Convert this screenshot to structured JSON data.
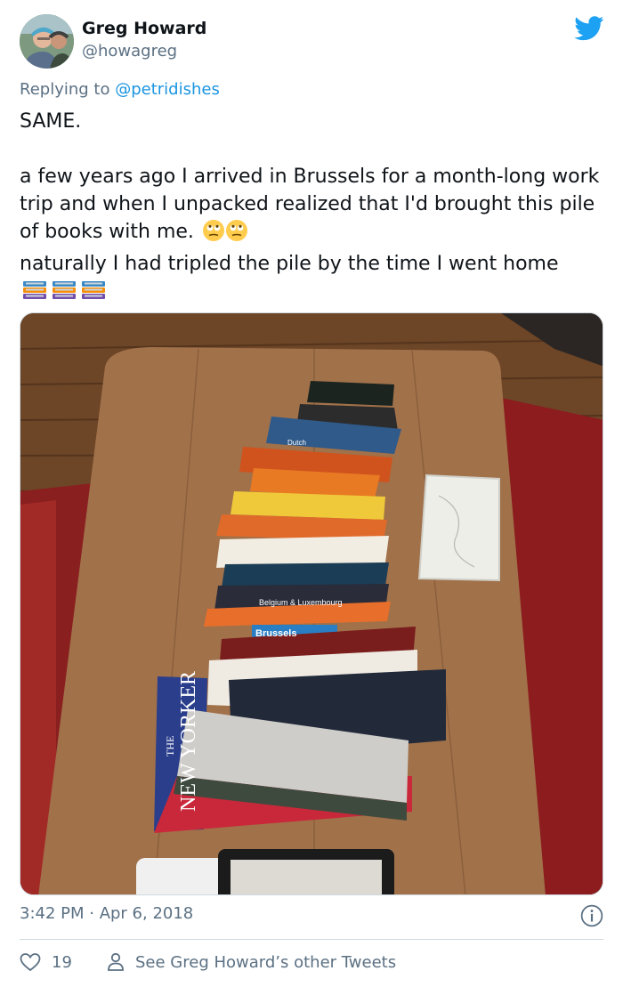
{
  "user": {
    "name": "Greg Howard",
    "handle": "@howagreg"
  },
  "reply": {
    "prefix": "Replying to ",
    "mention": "@petridishes"
  },
  "tweet": {
    "line1": "SAME.",
    "line2": "a few years ago I arrived in Brussels for a month-long work trip and when I unpacked realized that I'd brought this pile of books with me.",
    "line3": "naturally I had tripled the pile by the time I went home"
  },
  "photo_text": {
    "book_brussels": "Brussels",
    "book_belgium": "Belgium & Luxembourg",
    "book_dutch": "Dutch",
    "magazine_the": "THE",
    "magazine_title": "NEW YORKER"
  },
  "meta": {
    "time": "3:42 PM · Apr 6, 2018"
  },
  "actions": {
    "like_count": "19",
    "other_tweets": "See Greg Howard’s other Tweets"
  },
  "icons": [
    "twitter-bird-icon",
    "rolling-eyes-emoji",
    "books-emoji",
    "info-icon",
    "heart-icon",
    "person-icon"
  ],
  "colors": {
    "brand": "#1da1f2",
    "secondary_text": "#5b7083",
    "link": "#1b95e0"
  }
}
